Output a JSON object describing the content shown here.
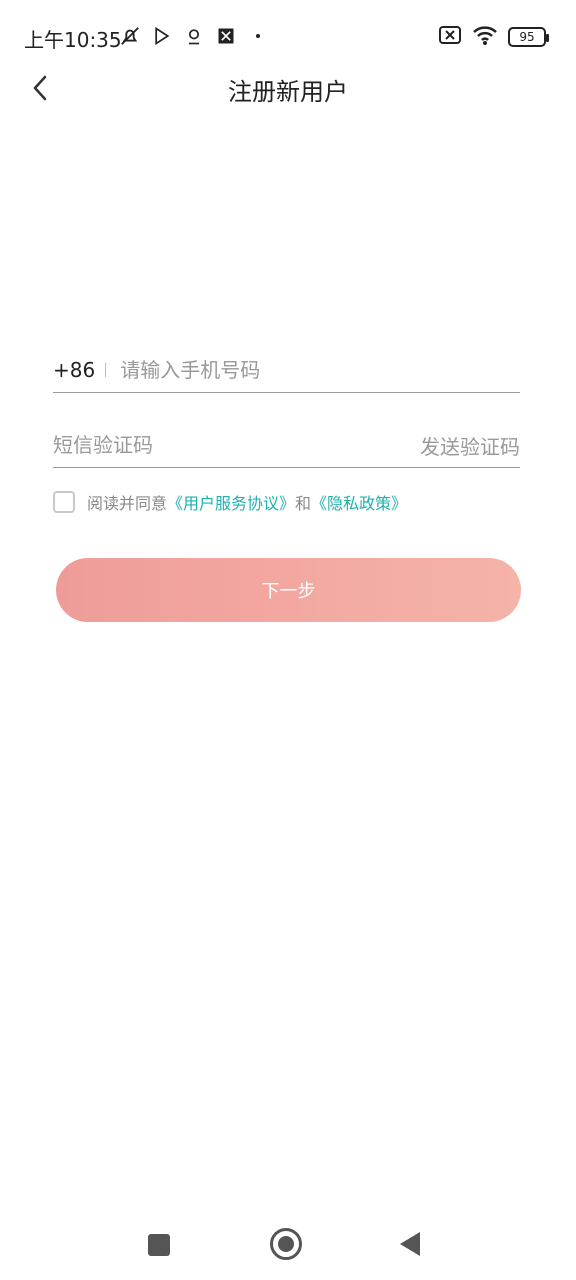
{
  "status_bar": {
    "time": "上午10:35",
    "icons_left": [
      "muted-bell-icon",
      "play-store-icon",
      "location-icon",
      "app-icon",
      "dot-icon"
    ],
    "icons_right": [
      "sim-x-icon",
      "wifi-icon",
      "battery-icon"
    ],
    "battery": "95"
  },
  "header": {
    "title": "注册新用户"
  },
  "form": {
    "country_code": "+86",
    "phone_placeholder": "请输入手机号码",
    "code_placeholder": "短信验证码",
    "send_code": "发送验证码"
  },
  "agreement": {
    "prefix": "阅读并同意",
    "terms": "《用户服务协议》",
    "and": "和",
    "privacy": "《隐私政策》"
  },
  "actions": {
    "next_label": "下一步"
  }
}
